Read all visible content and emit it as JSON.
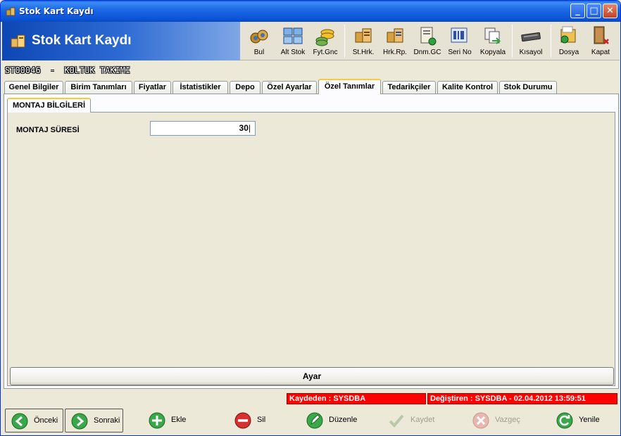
{
  "window": {
    "title": "Stok Kart Kaydı",
    "controls": [
      "minimize",
      "maximize",
      "close"
    ]
  },
  "banner": {
    "title": "Stok Kart Kaydı"
  },
  "toolbar": {
    "buttons": [
      {
        "label": "Bul",
        "icon": "binoculars-icon"
      },
      {
        "label": "Alt Stok",
        "icon": "substock-icon"
      },
      {
        "label": "Fyt.Gnc",
        "icon": "coins-icon"
      },
      {
        "label": "St.Hrk.",
        "icon": "stock-movement-icon"
      },
      {
        "label": "Hrk.Rp.",
        "icon": "movement-report-icon"
      },
      {
        "label": "Dnm.GC",
        "icon": "period-report-icon"
      },
      {
        "label": "Seri No",
        "icon": "serial-number-icon"
      },
      {
        "label": "Kopyala",
        "icon": "copy-icon"
      },
      {
        "label": "Kısayol",
        "icon": "keyboard-icon"
      },
      {
        "label": "Dosya",
        "icon": "file-icon"
      },
      {
        "label": "Kapat",
        "icon": "exit-door-icon"
      }
    ]
  },
  "record": {
    "code": "ST00046",
    "separator": "-",
    "name": "KOLTUK TAKIMI"
  },
  "tabs": [
    {
      "label": "Genel Bilgiler",
      "active": false
    },
    {
      "label": "Birim Tanımları",
      "active": false
    },
    {
      "label": "Fiyatlar",
      "active": false
    },
    {
      "label": "İstatistikler",
      "active": false
    },
    {
      "label": "Depo",
      "active": false
    },
    {
      "label": "Özel Ayarlar",
      "active": false
    },
    {
      "label": "Özel Tanımlar",
      "active": true
    },
    {
      "label": "Tedarikçiler",
      "active": false
    },
    {
      "label": "Kalite Kontrol",
      "active": false
    },
    {
      "label": "Stok Durumu",
      "active": false
    }
  ],
  "subtab": {
    "label": "MONTAJ BİLGİLERİ"
  },
  "form": {
    "montaj_label": "MONTAJ SÜRESİ",
    "montaj_value": "30"
  },
  "ayar_button": "Ayar",
  "status": {
    "created_by": "Kaydeden : SYSDBA",
    "modified_by": "Değiştiren : SYSDBA - 02.04.2012 13:59:51",
    "color": "#ff0000"
  },
  "bottom_buttons": [
    {
      "label": "Önceki",
      "icon": "arrow-left-icon",
      "enabled": true
    },
    {
      "label": "Sonraki",
      "icon": "arrow-right-icon",
      "enabled": true
    },
    {
      "label": "Ekle",
      "icon": "plus-icon",
      "enabled": true
    },
    {
      "label": "Sil",
      "icon": "minus-icon",
      "enabled": true
    },
    {
      "label": "Düzenle",
      "icon": "edit-icon",
      "enabled": true
    },
    {
      "label": "Kaydet",
      "icon": "check-icon",
      "enabled": false
    },
    {
      "label": "Vazgeç",
      "icon": "cancel-icon",
      "enabled": false
    },
    {
      "label": "Yenile",
      "icon": "refresh-icon",
      "enabled": true
    }
  ]
}
